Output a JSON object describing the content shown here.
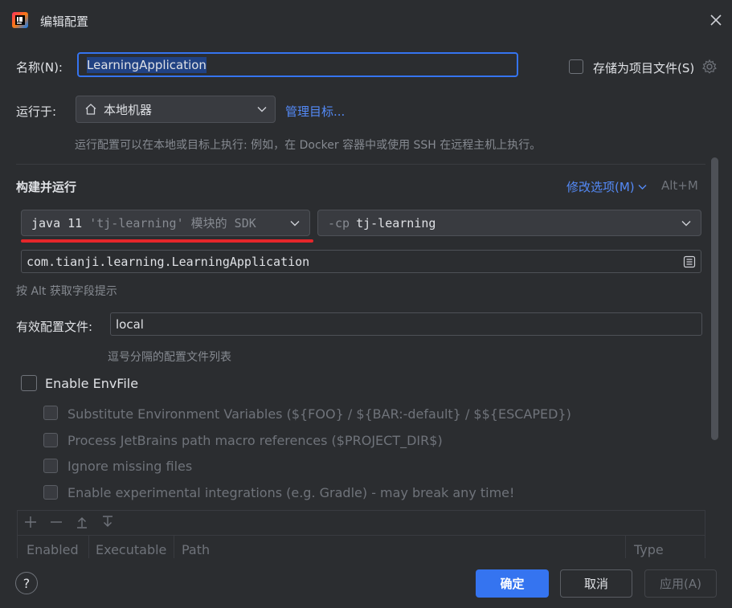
{
  "window": {
    "title": "编辑配置"
  },
  "name": {
    "label": "名称(N):",
    "value": "LearningApplication"
  },
  "store": {
    "label": "存储为项目文件(S)"
  },
  "run_on": {
    "label": "运行于:",
    "value": "本地机器",
    "manage_link": "管理目标...",
    "hint": "运行配置可以在本地或目标上执行: 例如，在 Docker 容器中或使用 SSH 在远程主机上执行。"
  },
  "build": {
    "title": "构建并运行",
    "modify_label": "修改选项(M)",
    "modify_shortcut": "Alt+M",
    "jdk_main": "java 11",
    "jdk_detail": "'tj-learning' 模块的 SDK",
    "cp_flag": "-cp",
    "cp_value": "tj-learning",
    "main_class": "com.tianji.learning.LearningApplication",
    "alt_hint": "按 Alt 获取字段提示"
  },
  "profiles": {
    "label": "有效配置文件:",
    "value": "local",
    "hint": "逗号分隔的配置文件列表"
  },
  "envfile": {
    "label": "Enable EnvFile",
    "options": [
      "Substitute Environment Variables (${FOO} / ${BAR:-default} / $${ESCAPED})",
      "Process JetBrains path macro references ($PROJECT_DIR$)",
      "Ignore missing files",
      "Enable experimental integrations (e.g. Gradle) - may break any time!"
    ],
    "columns": [
      "Enabled",
      "Executable",
      "Path",
      "Type"
    ]
  },
  "buttons": {
    "help": "?",
    "ok": "确定",
    "cancel": "取消",
    "apply": "应用(A)"
  },
  "colors": {
    "accent": "#3574f0",
    "link": "#548af7",
    "underline": "#e5262a",
    "background": "#2b2d30"
  }
}
